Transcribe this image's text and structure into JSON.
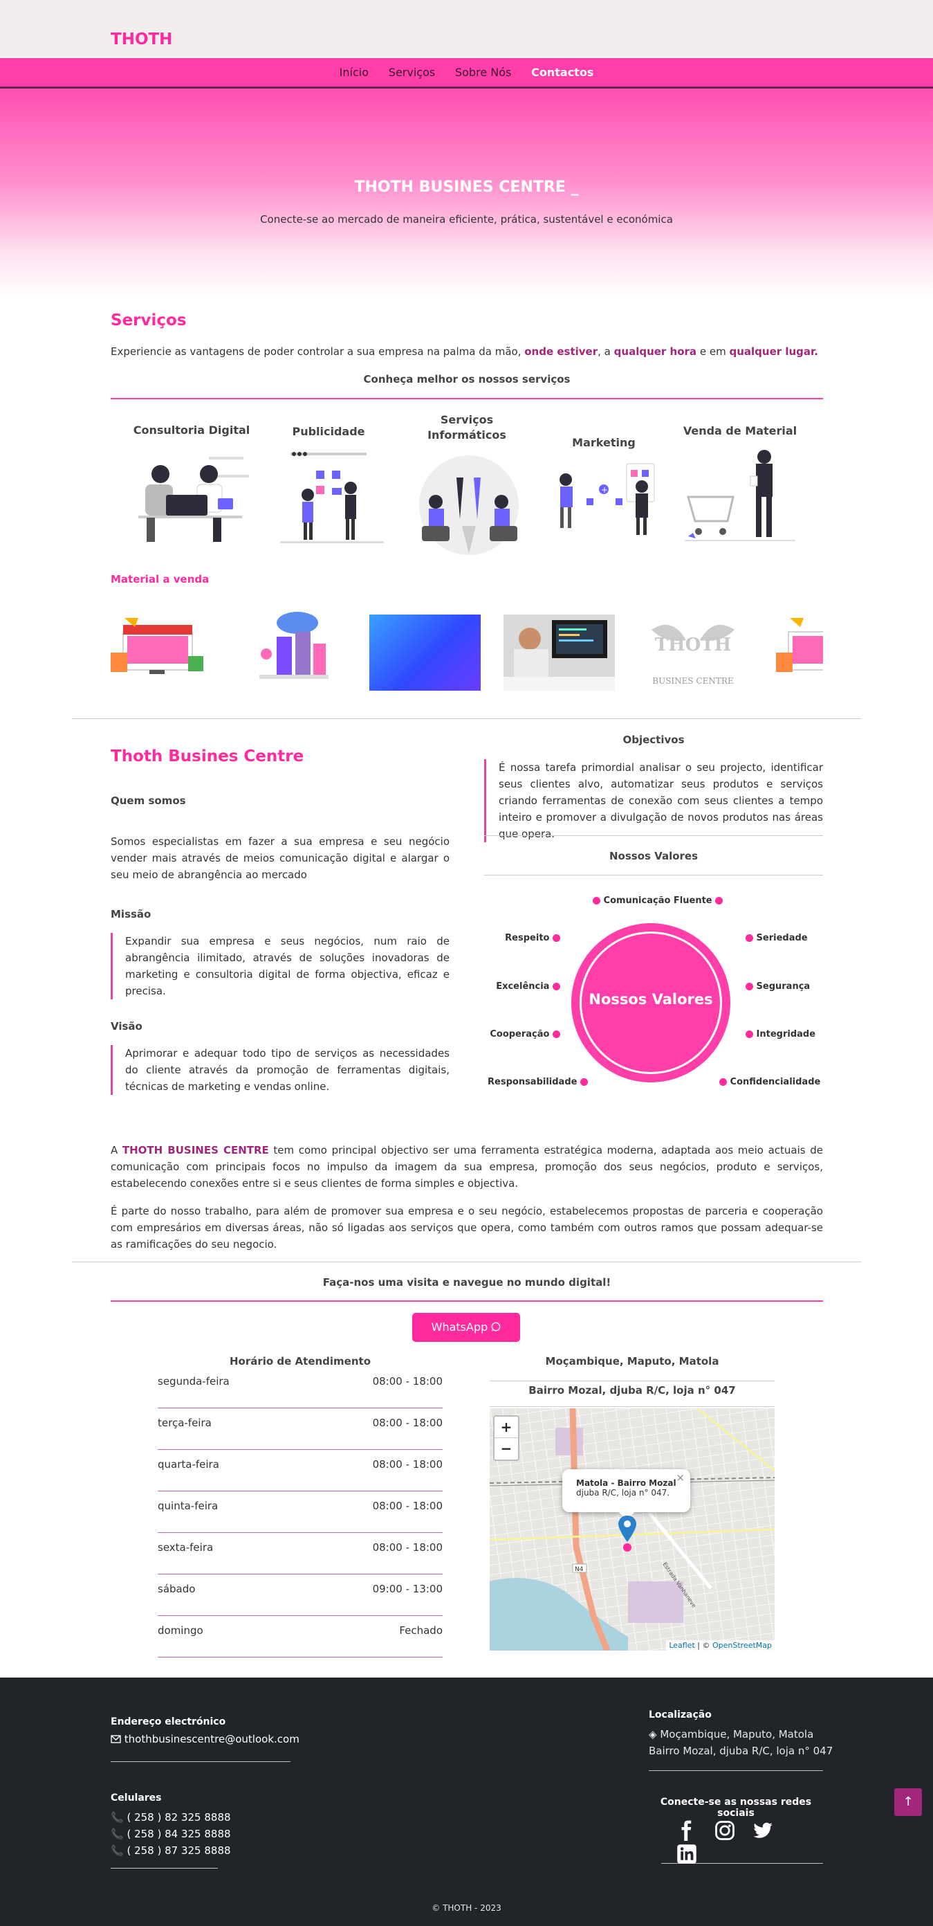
{
  "brand": "THOTH",
  "nav": [
    "Início",
    "Serviços",
    "Sobre Nós",
    "Contactos"
  ],
  "hero": {
    "title": "THOTH BUSINES CENTRE _",
    "subtitle": "Conecte-se ao mercado de maneira eficiente, prática, sustentável e económica"
  },
  "services": {
    "heading": "Serviços",
    "intro_prefix": "Experiencie as vantagens de poder controlar a sua empresa na palma da mão,",
    "highlight1": "onde estiver",
    "between1": ", a",
    "highlight2": "qualquer hora",
    "between2": "e em",
    "highlight3": "qualquer lugar.",
    "subheading": "Conheça melhor os nossos serviços",
    "items": [
      {
        "title": "Consultoria Digital"
      },
      {
        "title": "Publicidade"
      },
      {
        "title": "Serviços Informáticos"
      },
      {
        "title": "Marketing"
      },
      {
        "title": "Venda de Material"
      }
    ],
    "material_heading": "Material a venda",
    "material_logo_text": "THOTH",
    "material_logo_sub": "BUSINES CENTRE"
  },
  "about": {
    "heading": "Thoth Busines Centre",
    "who_title": "Quem somos",
    "who_text": "Somos especialistas em fazer a sua empresa e seu negócio vender mais através de meios comunicação digital e alargar o seu meio de abrangência ao mercado",
    "mission_title": "Missão",
    "mission_text": "Expandir sua empresa e seus negócios, num raio de abrangência ilimitado, através de soluções inovadoras de marketing e consultoria digital de forma objectiva, eficaz e precisa.",
    "vision_title": "Visão",
    "vision_text": "Aprimorar e adequar todo tipo de serviços as necessidades do cliente através da promoção de ferramentas digitais, técnicas de marketing e vendas online.",
    "objectives_title": "Objectivos",
    "objectives_text": "É nossa tarefa primordial analisar o seu projecto, identificar seus clientes alvo, automatizar seus produtos e serviços criando ferramentas de conexão com seus clientes a tempo inteiro e promover a divulgação de novos produtos nas áreas que opera.",
    "values_title": "Nossos Valores",
    "values_center": "Nossos Valores",
    "values": {
      "top": "Comunicação Fluente",
      "left": [
        "Respeito",
        "Excelência",
        "Cooperação",
        "Responsabilidade"
      ],
      "right": [
        "Seriedade",
        "Segurança",
        "Integridade",
        "Confidencialidade"
      ]
    },
    "para1_prefix": "A",
    "para1_brand": "THOTH BUSINES CENTRE",
    "para1_rest": "tem como principal objectivo ser uma ferramenta estratégica moderna, adaptada aos meio actuais de comunicação com principais focos no impulso da imagem da sua empresa, promoção dos seus negócios, produto e serviços, estabelecendo conexões entre si e seus clientes de forma simples e objectiva.",
    "para2": "É parte do nosso trabalho, para além de promover sua empresa e o seu negócio, estabelecemos propostas de parceria e cooperação com empresários em diversas áreas, não só ligadas aos serviços que opera, como também com outros ramos que possam adequar-se as ramificações do seu negocio."
  },
  "contact": {
    "heading": "Faça-nos uma visita e navegue no mundo digital!",
    "whatsapp": "WhatsApp",
    "hours_title": "Horário de Atendimento",
    "hours": [
      {
        "day": "segunda-feira",
        "time": "08:00 - 18:00"
      },
      {
        "day": "terça-feira",
        "time": "08:00 - 18:00"
      },
      {
        "day": "quarta-feira",
        "time": "08:00 - 18:00"
      },
      {
        "day": "quinta-feira",
        "time": "08:00 - 18:00"
      },
      {
        "day": "sexta-feira",
        "time": "08:00 - 18:00"
      },
      {
        "day": "sábado",
        "time": "09:00 - 13:00"
      },
      {
        "day": "domingo",
        "time": "Fechado"
      }
    ],
    "location_title": "Moçambique, Maputo, Matola",
    "location_sub": "Bairro Mozal, djuba R/C, loja n° 047",
    "map": {
      "zoom_in": "+",
      "zoom_out": "−",
      "popup_title": "Matola - Bairro Mozal",
      "popup_text": "djuba R/C, loja n° 047.",
      "popup_close": "×",
      "road_label": "N4",
      "street_label": "Estrada Vanhaneve",
      "attribution_leaflet": "Leaflet",
      "attribution_sep": "| ©",
      "attribution_osm": "OpenStreetMap"
    }
  },
  "footer": {
    "email_title": "Endereço electrónico",
    "email": "thothbusinescentre@outlook.com",
    "phones_title": "Celulares",
    "phones": [
      "( 258 ) 82 325 8888",
      "( 258 ) 84 325 8888",
      "( 258 ) 87 325 8888"
    ],
    "loc_title": "Localização",
    "loc_line1": "Moçambique, Maputo, Matola",
    "loc_line2": "Bairro Mozal, djuba R/C, loja n° 047",
    "social_title": "Conecte-se as nossas redes sociais",
    "copyright": "© THOTH - 2023"
  },
  "colors": {
    "accent": "#ff2a9d",
    "footer": "#212529",
    "dark_pink": "#a0277a"
  }
}
